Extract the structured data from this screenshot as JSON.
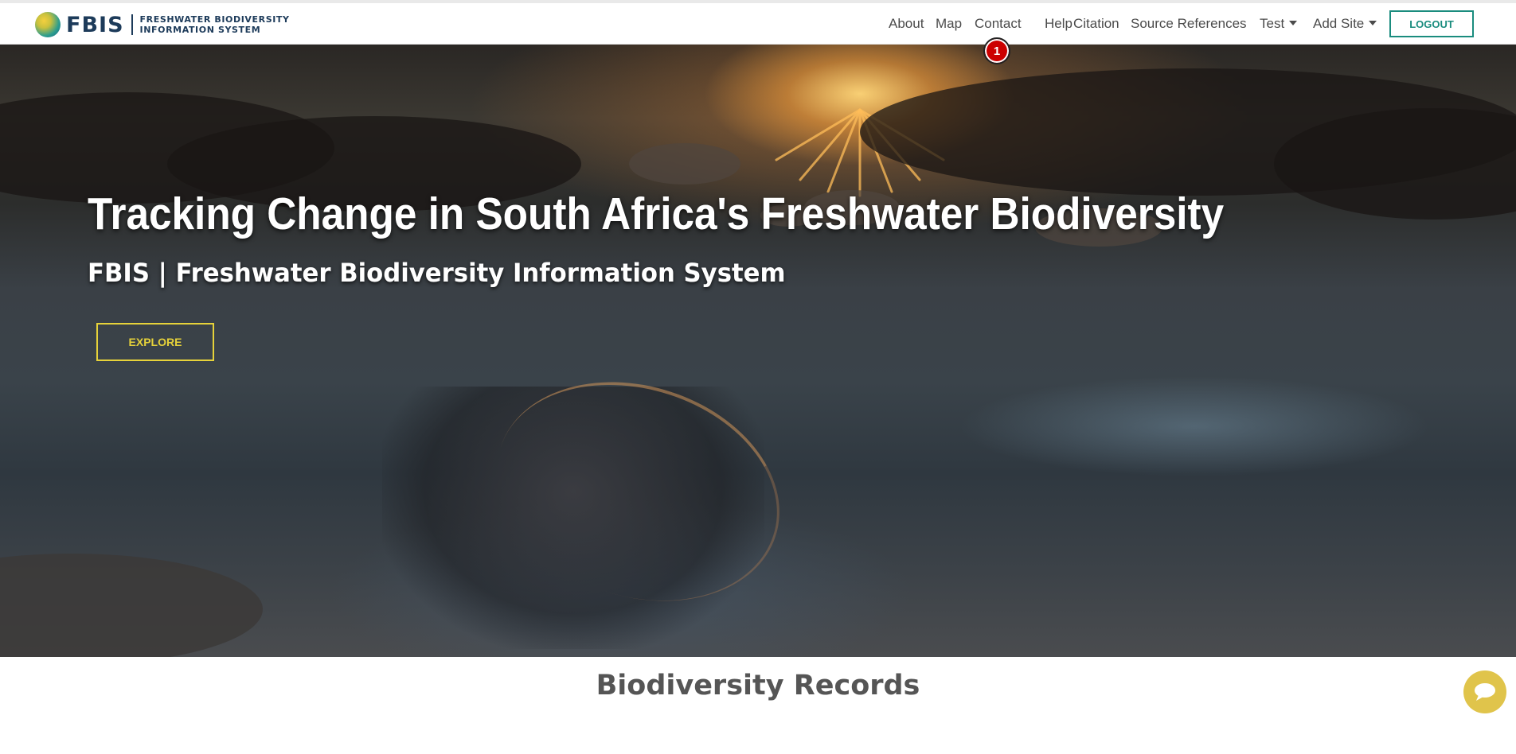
{
  "brand": {
    "wordmark": "FBIS",
    "subtitle_line1": "FRESHWATER BIODIVERSITY",
    "subtitle_line2": "INFORMATION SYSTEM"
  },
  "nav": {
    "links": [
      "About",
      "Map",
      "Contact",
      "Help",
      "Citation",
      "Source References"
    ],
    "dropdowns": [
      "Test",
      "Add Site"
    ],
    "logout_label": "LOGOUT",
    "notification_count": "1"
  },
  "hero": {
    "title": "Tracking Change in South Africa's Freshwater Biodiversity",
    "subtitle": "FBIS | Freshwater Biodiversity Information System",
    "button_label": "EXPLORE"
  },
  "records": {
    "title": "Biodiversity Records"
  },
  "colors": {
    "accent_teal": "#1a8c7e",
    "explore_yellow": "#e6d23a",
    "chat_yellow": "#e0c44b",
    "badge_red": "#cc0000"
  }
}
